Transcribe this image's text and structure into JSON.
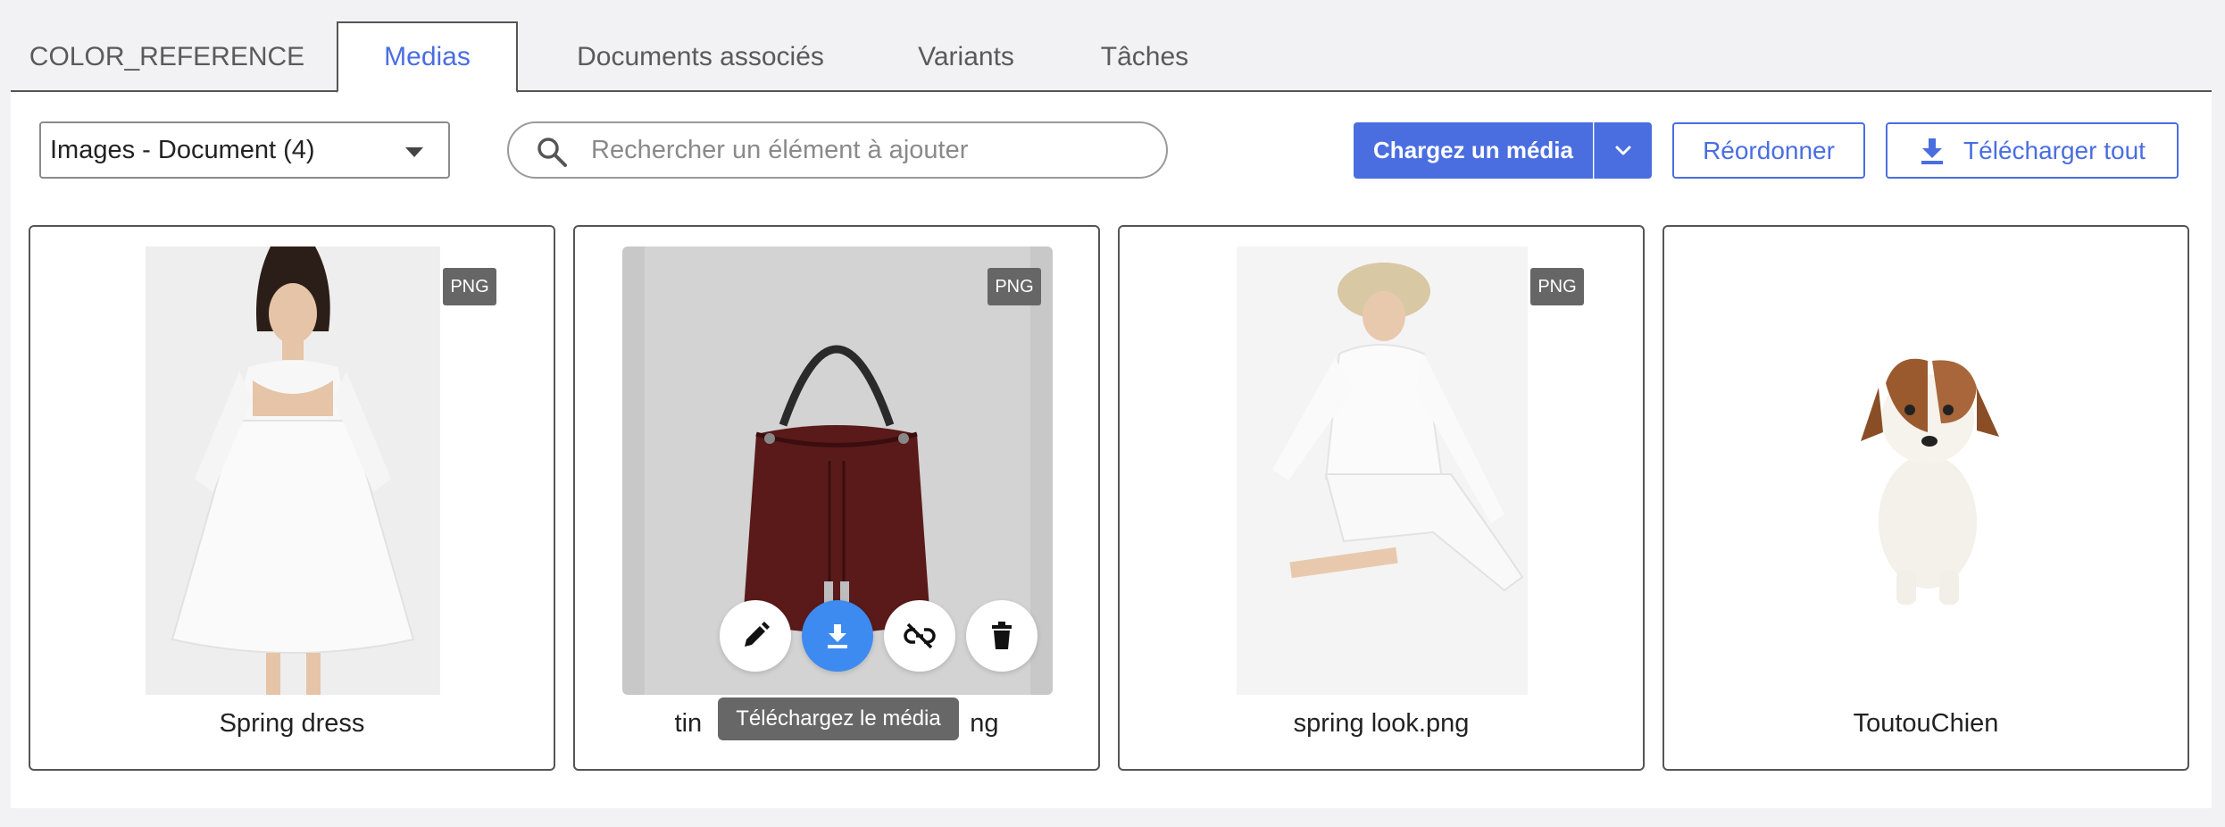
{
  "tabs": [
    {
      "label": "COLOR_REFERENCE",
      "active": false
    },
    {
      "label": "Medias",
      "active": true
    },
    {
      "label": "Documents associés",
      "active": false
    },
    {
      "label": "Variants",
      "active": false
    },
    {
      "label": "Tâches",
      "active": false
    }
  ],
  "toolbar": {
    "filter_value": "Images - Document (4)",
    "search_placeholder": "Rechercher un élément à ajouter",
    "upload_label": "Chargez un média",
    "reorder_label": "Réordonner",
    "download_all_label": "Télécharger tout"
  },
  "cards": [
    {
      "caption": "Spring dress",
      "badge": "PNG"
    },
    {
      "caption_left": "tin",
      "caption_right": "ng",
      "badge": "PNG"
    },
    {
      "caption": "spring look.png",
      "badge": "PNG"
    },
    {
      "caption": "ToutouChien"
    }
  ],
  "tooltip": "Téléchargez le média",
  "colors": {
    "accent": "#4a6ee0",
    "download_action": "#3d8bf0",
    "badge": "#666666"
  },
  "icons": {
    "search": "search-icon",
    "chevron": "chevron-down-icon",
    "download": "download-icon",
    "edit": "pencil-icon",
    "unlink": "unlink-icon",
    "delete": "trash-icon"
  }
}
